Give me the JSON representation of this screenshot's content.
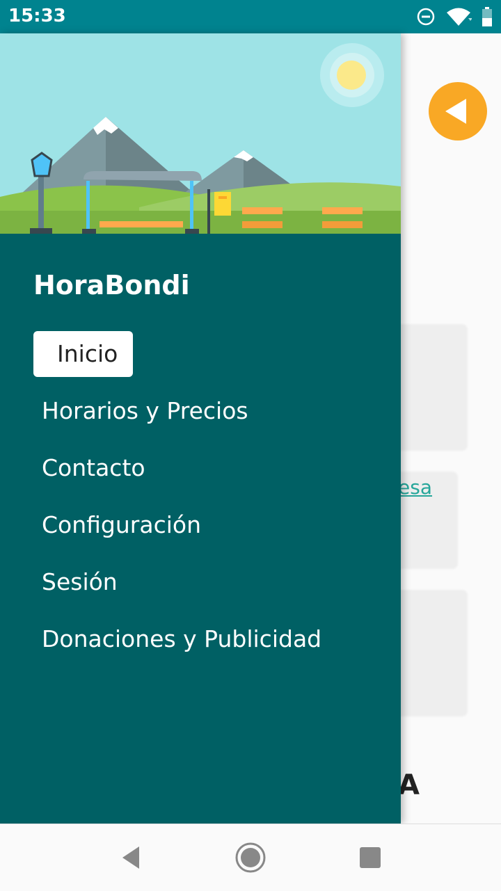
{
  "status_bar": {
    "time": "15:33"
  },
  "drawer": {
    "app_title": "HoraBondi",
    "menu": [
      {
        "label": "Inicio",
        "active": true
      },
      {
        "label": "Horarios y Precios",
        "active": false
      },
      {
        "label": "Contacto",
        "active": false
      },
      {
        "label": "Configuración",
        "active": false
      },
      {
        "label": "Sesión",
        "active": false
      },
      {
        "label": "Donaciones y Publicidad",
        "active": false
      }
    ]
  },
  "background": {
    "link_fragment": "esa",
    "letter_fragment": "A"
  },
  "colors": {
    "status_bar": "#00838f",
    "drawer": "#006064",
    "accent": "#f9a825",
    "link": "#26a69a"
  },
  "icons": [
    "do-not-disturb-icon",
    "wifi-icon",
    "battery-icon",
    "back-arrow-icon",
    "nav-back-icon",
    "nav-home-icon",
    "nav-recents-icon"
  ]
}
